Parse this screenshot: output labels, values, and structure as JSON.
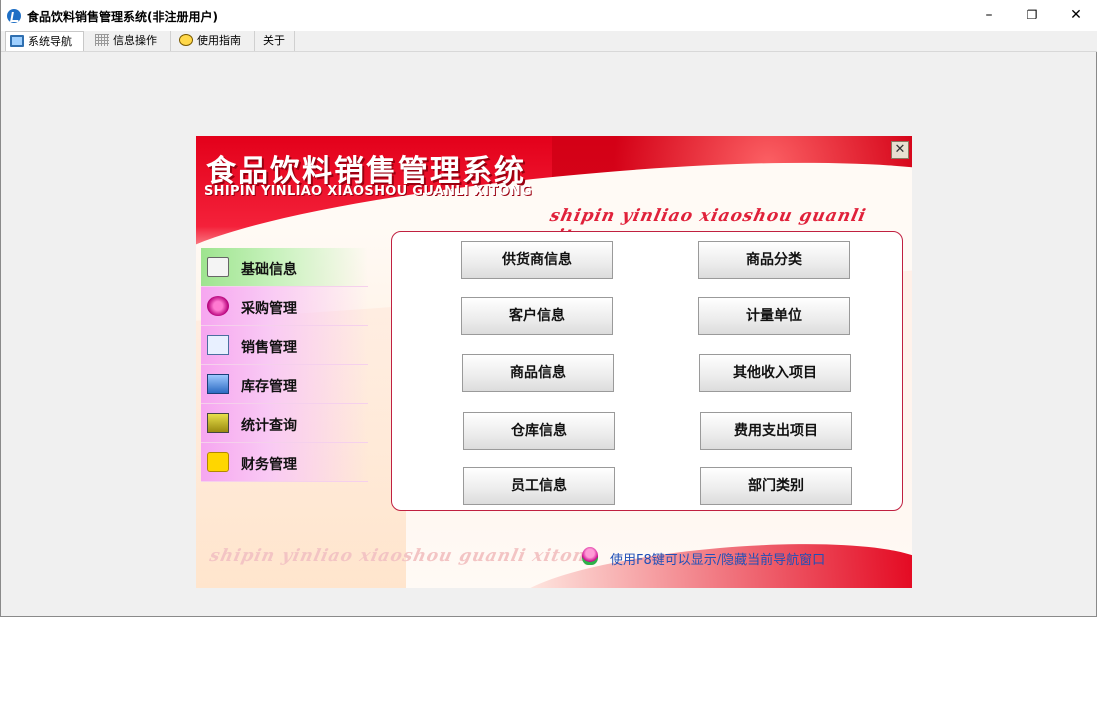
{
  "window": {
    "title": "食品饮料销售管理系统(非注册用户)",
    "controls": {
      "minimize": "–",
      "restore": "❐",
      "close": "✕"
    }
  },
  "menu": {
    "tabs": [
      {
        "label": "系统导航",
        "icon": "monitor-icon",
        "active": true
      },
      {
        "label": "信息操作",
        "icon": "grid-icon",
        "active": false
      },
      {
        "label": "使用指南",
        "icon": "bulb-icon",
        "active": false
      },
      {
        "label": "关于",
        "icon": "",
        "active": false
      }
    ]
  },
  "panel": {
    "title_cn": "食品饮料销售管理系统",
    "title_en": "SHIPIN YINLIAO XIAOSHOU GUANLI XITONG",
    "slogan": "shipin yinliao xiaoshou guanli xitong",
    "close_label": "✕",
    "hint": "使用F8键可以显示/隐藏当前导航窗口",
    "colors": {
      "accent": "#e3001a",
      "nav_active": "#9ee48f",
      "nav_item": "#f6a6f0",
      "hint_text": "#2050b8"
    }
  },
  "nav": {
    "items": [
      {
        "label": "基础信息",
        "icon": "book-icon",
        "active": true
      },
      {
        "label": "采购管理",
        "icon": "gear-icon",
        "active": false
      },
      {
        "label": "销售管理",
        "icon": "document-icon",
        "active": false
      },
      {
        "label": "库存管理",
        "icon": "store-icon",
        "active": false
      },
      {
        "label": "统计查询",
        "icon": "chart-icon",
        "active": false
      },
      {
        "label": "财务管理",
        "icon": "finance-icon",
        "active": false
      }
    ]
  },
  "functions": {
    "left": [
      "供货商信息",
      "客户信息",
      "商品信息",
      "仓库信息",
      "员工信息"
    ],
    "right": [
      "商品分类",
      "计量单位",
      "其他收入项目",
      "费用支出项目",
      "部门类别"
    ]
  }
}
